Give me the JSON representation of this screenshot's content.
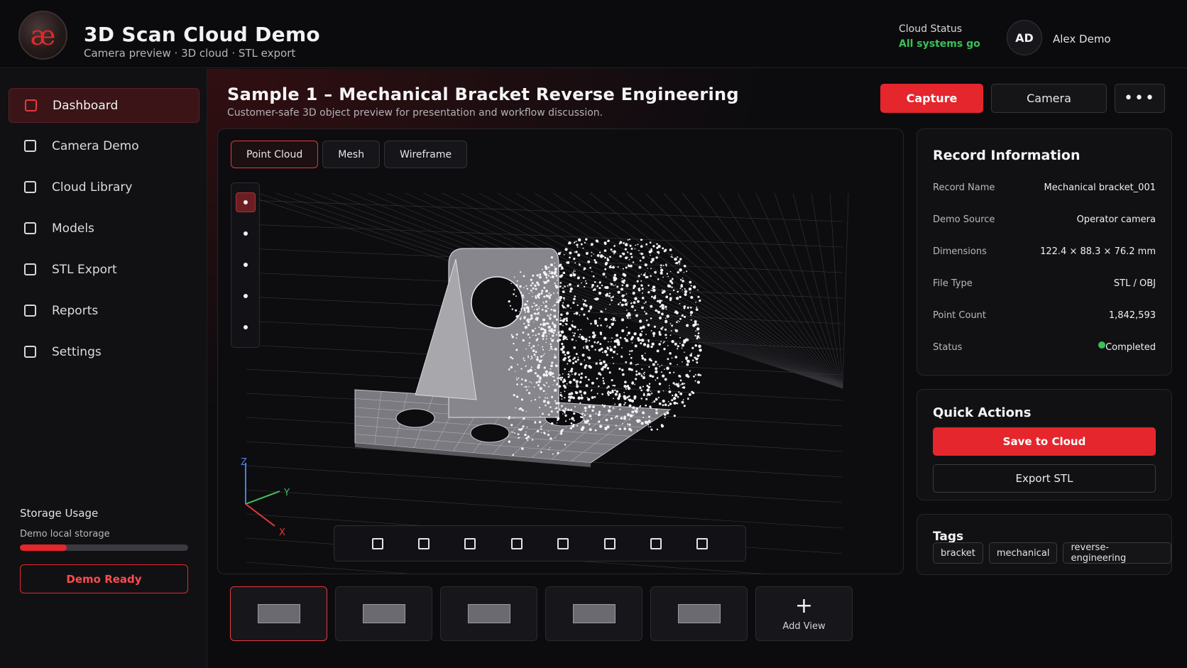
{
  "header": {
    "logo_glyph": "æ",
    "title": "3D Scan Cloud Demo",
    "subtitle": "Camera preview · 3D cloud · STL export",
    "cloud_status_label": "Cloud Status",
    "cloud_status_value": "All systems go",
    "user_initials": "AD",
    "user_name": "Alex Demo"
  },
  "sidebar": {
    "items": [
      {
        "label": "Dashboard",
        "active": true
      },
      {
        "label": "Camera Demo"
      },
      {
        "label": "Cloud Library"
      },
      {
        "label": "Models"
      },
      {
        "label": "STL Export"
      },
      {
        "label": "Reports"
      },
      {
        "label": "Settings"
      }
    ],
    "storage": {
      "title": "Storage Usage",
      "subtitle": "Demo local storage",
      "used_fraction": 0.28
    },
    "demo_ready_label": "Demo Ready"
  },
  "main": {
    "title": "Sample 1 – Mechanical Bracket Reverse Engineering",
    "subtitle": "Customer-safe 3D object preview for presentation and workflow discussion.",
    "actions": {
      "capture": "Capture",
      "camera": "Camera",
      "more": "•••"
    },
    "view_tabs": [
      "Point Cloud",
      "Mesh",
      "Wireframe"
    ],
    "active_view_tab": "Point Cloud",
    "axes": {
      "x": "X",
      "y": "Y",
      "z": "Z"
    },
    "thumbnails_count": 5,
    "add_view_label": "Add View"
  },
  "record": {
    "title": "Record Information",
    "rows": [
      {
        "key": "Record Name",
        "value": "Mechanical bracket_001"
      },
      {
        "key": "Demo Source",
        "value": "Operator camera"
      },
      {
        "key": "Dimensions",
        "value": "122.4 × 88.3 × 76.2 mm"
      },
      {
        "key": "File Type",
        "value": "STL / OBJ"
      },
      {
        "key": "Point Count",
        "value": "1,842,593"
      },
      {
        "key": "Status",
        "value": "Completed"
      }
    ]
  },
  "quick_actions": {
    "title": "Quick Actions",
    "save": "Save to Cloud",
    "export": "Export STL"
  },
  "tags": {
    "title": "Tags",
    "items": [
      "bracket",
      "mechanical",
      "reverse-engineering"
    ]
  },
  "colors": {
    "accent": "#e5262c",
    "status_ok": "#37c25a",
    "background": "#0c0c0f"
  }
}
